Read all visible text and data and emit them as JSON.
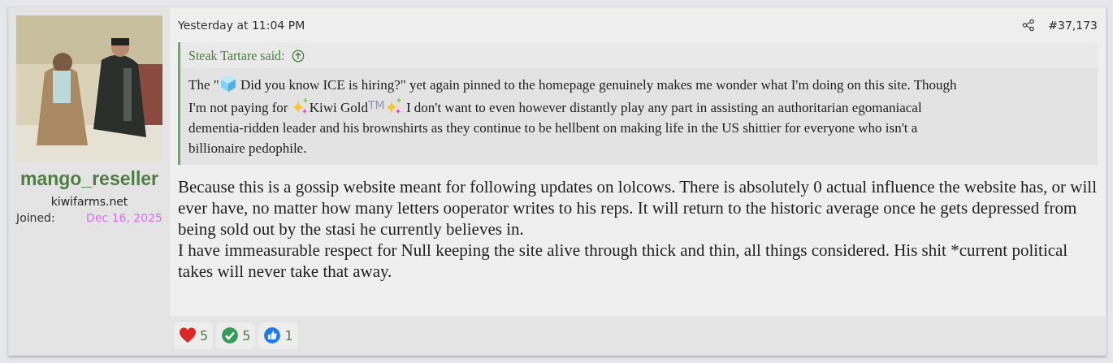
{
  "post": {
    "author": {
      "username": "mango_reseller",
      "user_title": "kiwifarms.net",
      "joined_label": "Joined:",
      "joined_date": "Dec 16, 2025"
    },
    "date": "Yesterday at 11:04 PM",
    "post_number": "#37,173",
    "quote": {
      "attribution": "Steak Tartare said:",
      "lines": [
        [
          {
            "kind": "text",
            "text": "The \""
          },
          {
            "kind": "ice_cube"
          },
          {
            "kind": "text",
            "text": " Did you know ICE is hiring?\" yet again pinned to the homepage genuinely makes me wonder what I'm doing on this site. Though"
          }
        ],
        [
          {
            "kind": "text",
            "text": "I'm not paying for "
          },
          {
            "kind": "sparkles"
          },
          {
            "kind": "text",
            "text": "Kiwi Gold$^{TM}$"
          },
          {
            "kind": "sparkles"
          },
          {
            "kind": "text",
            "text": " I don't want to even however distantly play any part in assisting an authoritarian egomaniacal"
          }
        ],
        [
          {
            "kind": "text",
            "text": "dementia-ridden leader and his brownshirts as they continue to be hellbent on making life in the US shittier for everyone who isn't a"
          }
        ],
        [
          {
            "kind": "text",
            "text": "billionaire pedophile."
          }
        ]
      ]
    },
    "body": [
      "Because this is a gossip website meant for following updates on lolcows. There is absolutely 0 actual influence the website has, or will ever have, no matter how many letters ooperator writes to his reps. It will return to the historic average once he gets depressed from being sold out by the stasi he currently believes in.",
      "I have immeasurable respect for Null keeping the site alive through thick and thin, all things considered. His shit *current political takes will never take that away."
    ],
    "reactions": [
      {
        "kind": "heart",
        "count": "5"
      },
      {
        "kind": "check",
        "count": "5"
      },
      {
        "kind": "thumbs_up",
        "count": "1"
      }
    ]
  }
}
